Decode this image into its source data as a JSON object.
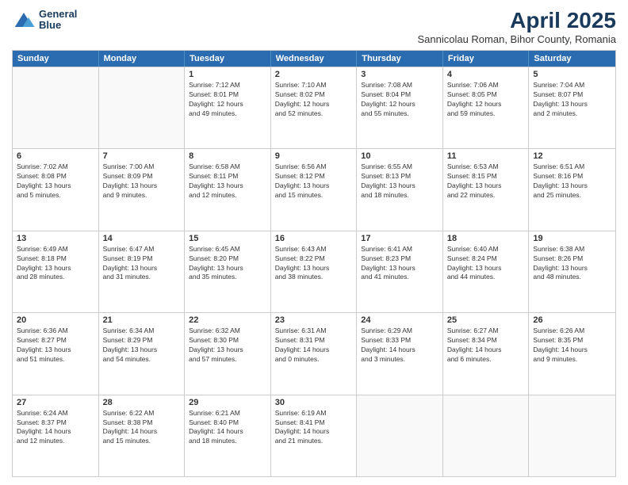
{
  "header": {
    "logo_line1": "General",
    "logo_line2": "Blue",
    "title": "April 2025",
    "subtitle": "Sannicolau Roman, Bihor County, Romania"
  },
  "days_of_week": [
    "Sunday",
    "Monday",
    "Tuesday",
    "Wednesday",
    "Thursday",
    "Friday",
    "Saturday"
  ],
  "weeks": [
    [
      {
        "day": "",
        "info": ""
      },
      {
        "day": "",
        "info": ""
      },
      {
        "day": "1",
        "info": "Sunrise: 7:12 AM\nSunset: 8:01 PM\nDaylight: 12 hours\nand 49 minutes."
      },
      {
        "day": "2",
        "info": "Sunrise: 7:10 AM\nSunset: 8:02 PM\nDaylight: 12 hours\nand 52 minutes."
      },
      {
        "day": "3",
        "info": "Sunrise: 7:08 AM\nSunset: 8:04 PM\nDaylight: 12 hours\nand 55 minutes."
      },
      {
        "day": "4",
        "info": "Sunrise: 7:06 AM\nSunset: 8:05 PM\nDaylight: 12 hours\nand 59 minutes."
      },
      {
        "day": "5",
        "info": "Sunrise: 7:04 AM\nSunset: 8:07 PM\nDaylight: 13 hours\nand 2 minutes."
      }
    ],
    [
      {
        "day": "6",
        "info": "Sunrise: 7:02 AM\nSunset: 8:08 PM\nDaylight: 13 hours\nand 5 minutes."
      },
      {
        "day": "7",
        "info": "Sunrise: 7:00 AM\nSunset: 8:09 PM\nDaylight: 13 hours\nand 9 minutes."
      },
      {
        "day": "8",
        "info": "Sunrise: 6:58 AM\nSunset: 8:11 PM\nDaylight: 13 hours\nand 12 minutes."
      },
      {
        "day": "9",
        "info": "Sunrise: 6:56 AM\nSunset: 8:12 PM\nDaylight: 13 hours\nand 15 minutes."
      },
      {
        "day": "10",
        "info": "Sunrise: 6:55 AM\nSunset: 8:13 PM\nDaylight: 13 hours\nand 18 minutes."
      },
      {
        "day": "11",
        "info": "Sunrise: 6:53 AM\nSunset: 8:15 PM\nDaylight: 13 hours\nand 22 minutes."
      },
      {
        "day": "12",
        "info": "Sunrise: 6:51 AM\nSunset: 8:16 PM\nDaylight: 13 hours\nand 25 minutes."
      }
    ],
    [
      {
        "day": "13",
        "info": "Sunrise: 6:49 AM\nSunset: 8:18 PM\nDaylight: 13 hours\nand 28 minutes."
      },
      {
        "day": "14",
        "info": "Sunrise: 6:47 AM\nSunset: 8:19 PM\nDaylight: 13 hours\nand 31 minutes."
      },
      {
        "day": "15",
        "info": "Sunrise: 6:45 AM\nSunset: 8:20 PM\nDaylight: 13 hours\nand 35 minutes."
      },
      {
        "day": "16",
        "info": "Sunrise: 6:43 AM\nSunset: 8:22 PM\nDaylight: 13 hours\nand 38 minutes."
      },
      {
        "day": "17",
        "info": "Sunrise: 6:41 AM\nSunset: 8:23 PM\nDaylight: 13 hours\nand 41 minutes."
      },
      {
        "day": "18",
        "info": "Sunrise: 6:40 AM\nSunset: 8:24 PM\nDaylight: 13 hours\nand 44 minutes."
      },
      {
        "day": "19",
        "info": "Sunrise: 6:38 AM\nSunset: 8:26 PM\nDaylight: 13 hours\nand 48 minutes."
      }
    ],
    [
      {
        "day": "20",
        "info": "Sunrise: 6:36 AM\nSunset: 8:27 PM\nDaylight: 13 hours\nand 51 minutes."
      },
      {
        "day": "21",
        "info": "Sunrise: 6:34 AM\nSunset: 8:29 PM\nDaylight: 13 hours\nand 54 minutes."
      },
      {
        "day": "22",
        "info": "Sunrise: 6:32 AM\nSunset: 8:30 PM\nDaylight: 13 hours\nand 57 minutes."
      },
      {
        "day": "23",
        "info": "Sunrise: 6:31 AM\nSunset: 8:31 PM\nDaylight: 14 hours\nand 0 minutes."
      },
      {
        "day": "24",
        "info": "Sunrise: 6:29 AM\nSunset: 8:33 PM\nDaylight: 14 hours\nand 3 minutes."
      },
      {
        "day": "25",
        "info": "Sunrise: 6:27 AM\nSunset: 8:34 PM\nDaylight: 14 hours\nand 6 minutes."
      },
      {
        "day": "26",
        "info": "Sunrise: 6:26 AM\nSunset: 8:35 PM\nDaylight: 14 hours\nand 9 minutes."
      }
    ],
    [
      {
        "day": "27",
        "info": "Sunrise: 6:24 AM\nSunset: 8:37 PM\nDaylight: 14 hours\nand 12 minutes."
      },
      {
        "day": "28",
        "info": "Sunrise: 6:22 AM\nSunset: 8:38 PM\nDaylight: 14 hours\nand 15 minutes."
      },
      {
        "day": "29",
        "info": "Sunrise: 6:21 AM\nSunset: 8:40 PM\nDaylight: 14 hours\nand 18 minutes."
      },
      {
        "day": "30",
        "info": "Sunrise: 6:19 AM\nSunset: 8:41 PM\nDaylight: 14 hours\nand 21 minutes."
      },
      {
        "day": "",
        "info": ""
      },
      {
        "day": "",
        "info": ""
      },
      {
        "day": "",
        "info": ""
      }
    ]
  ]
}
